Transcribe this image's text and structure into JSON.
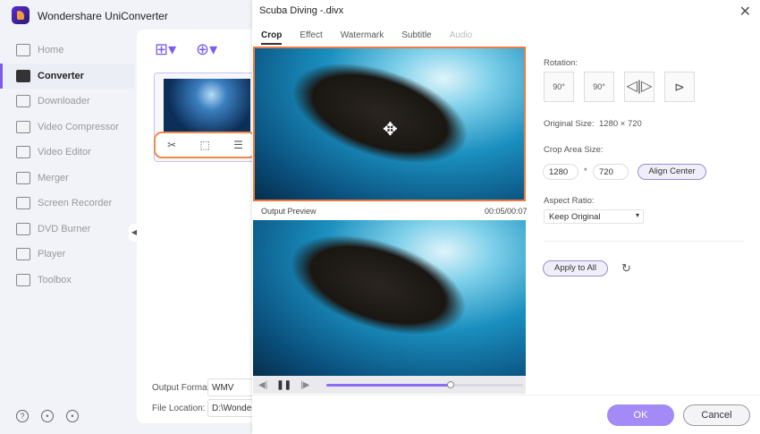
{
  "app": {
    "title": "Wondershare UniConverter"
  },
  "sidebar": {
    "items": [
      {
        "label": "Home"
      },
      {
        "label": "Converter",
        "active": true
      },
      {
        "label": "Downloader"
      },
      {
        "label": "Video Compressor"
      },
      {
        "label": "Video Editor"
      },
      {
        "label": "Merger"
      },
      {
        "label": "Screen Recorder"
      },
      {
        "label": "DVD Burner"
      },
      {
        "label": "Player"
      },
      {
        "label": "Toolbox"
      }
    ]
  },
  "content": {
    "output_format_label": "Output Format:",
    "output_format_value": "WMV",
    "file_location_label": "File Location:",
    "file_location_value": "D:\\Wonders"
  },
  "dialog": {
    "title": "Scuba Diving -.divx",
    "close": "✕",
    "tabs": [
      {
        "label": "Crop",
        "active": true
      },
      {
        "label": "Effect"
      },
      {
        "label": "Watermark"
      },
      {
        "label": "Subtitle"
      },
      {
        "label": "Audio",
        "disabled": true
      }
    ],
    "output_preview_label": "Output Preview",
    "time": "00:05/00:07",
    "progress_percent": 63,
    "rotation_label": "Rotation:",
    "rotate_cw": "90°",
    "rotate_ccw": "90°",
    "original_size_label": "Original Size:",
    "original_size_value": "1280 × 720",
    "crop_area_label": "Crop Area Size:",
    "crop_width": "1280",
    "crop_sep": "*",
    "crop_height": "720",
    "align_center": "Align Center",
    "aspect_ratio_label": "Aspect Ratio:",
    "aspect_ratio_value": "Keep Original",
    "apply_all": "Apply to All",
    "ok": "OK",
    "cancel": "Cancel"
  },
  "colors": {
    "accent": "#7b5cf0",
    "crop_border": "#f07a3c",
    "ok_button": "#a48af6"
  }
}
